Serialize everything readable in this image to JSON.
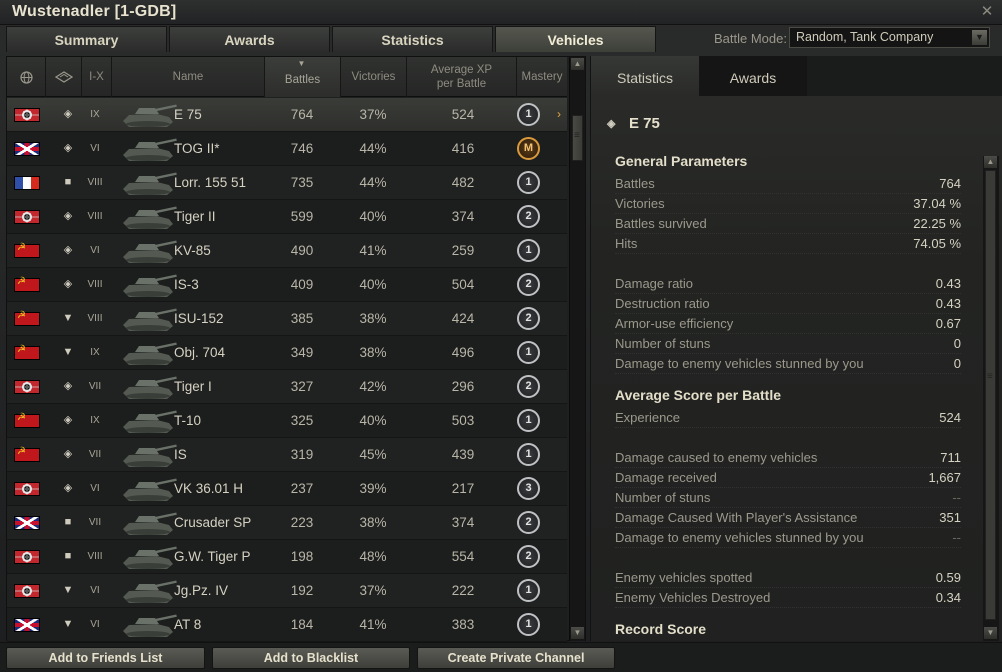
{
  "window": {
    "title": "Wustenadler [1-GDB]"
  },
  "tabs": [
    {
      "label": "Summary",
      "active": false
    },
    {
      "label": "Awards",
      "active": false
    },
    {
      "label": "Statistics",
      "active": false
    },
    {
      "label": "Vehicles",
      "active": true
    }
  ],
  "battle_mode": {
    "label": "Battle Mode:",
    "value": "Random, Tank Company"
  },
  "table": {
    "headers": {
      "name": "Name",
      "battles": "Battles",
      "victories": "Victories",
      "avg_xp_line1": "Average XP",
      "avg_xp_line2": "per Battle",
      "mastery": "Mastery",
      "tier": "I-X"
    },
    "rows": [
      {
        "nation": "de",
        "cls": "heavy",
        "tier": "IX",
        "name": "E 75",
        "battles": "764",
        "victories": "37%",
        "avg_xp": "524",
        "mastery": "1",
        "selected": true
      },
      {
        "nation": "gb",
        "cls": "heavy",
        "tier": "VI",
        "name": "TOG II*",
        "battles": "746",
        "victories": "44%",
        "avg_xp": "416",
        "mastery": "M"
      },
      {
        "nation": "fr",
        "cls": "spg",
        "tier": "VIII",
        "name": "Lorr. 155 51",
        "battles": "735",
        "victories": "44%",
        "avg_xp": "482",
        "mastery": "1"
      },
      {
        "nation": "de",
        "cls": "heavy",
        "tier": "VIII",
        "name": "Tiger II",
        "battles": "599",
        "victories": "40%",
        "avg_xp": "374",
        "mastery": "2"
      },
      {
        "nation": "su",
        "cls": "heavy",
        "tier": "VI",
        "name": "KV-85",
        "battles": "490",
        "victories": "41%",
        "avg_xp": "259",
        "mastery": "1"
      },
      {
        "nation": "su",
        "cls": "heavy",
        "tier": "VIII",
        "name": "IS-3",
        "battles": "409",
        "victories": "40%",
        "avg_xp": "504",
        "mastery": "2"
      },
      {
        "nation": "su",
        "cls": "td",
        "tier": "VIII",
        "name": "ISU-152",
        "battles": "385",
        "victories": "38%",
        "avg_xp": "424",
        "mastery": "2"
      },
      {
        "nation": "su",
        "cls": "td",
        "tier": "IX",
        "name": "Obj. 704",
        "battles": "349",
        "victories": "38%",
        "avg_xp": "496",
        "mastery": "1"
      },
      {
        "nation": "de",
        "cls": "heavy",
        "tier": "VII",
        "name": "Tiger I",
        "battles": "327",
        "victories": "42%",
        "avg_xp": "296",
        "mastery": "2"
      },
      {
        "nation": "su",
        "cls": "heavy",
        "tier": "IX",
        "name": "T-10",
        "battles": "325",
        "victories": "40%",
        "avg_xp": "503",
        "mastery": "1"
      },
      {
        "nation": "su",
        "cls": "heavy",
        "tier": "VII",
        "name": "IS",
        "battles": "319",
        "victories": "45%",
        "avg_xp": "439",
        "mastery": "1"
      },
      {
        "nation": "de",
        "cls": "heavy",
        "tier": "VI",
        "name": "VK 36.01 H",
        "battles": "237",
        "victories": "39%",
        "avg_xp": "217",
        "mastery": "3"
      },
      {
        "nation": "gb",
        "cls": "spg",
        "tier": "VII",
        "name": "Crusader SP",
        "battles": "223",
        "victories": "38%",
        "avg_xp": "374",
        "mastery": "2"
      },
      {
        "nation": "de",
        "cls": "spg",
        "tier": "VIII",
        "name": "G.W. Tiger P",
        "battles": "198",
        "victories": "48%",
        "avg_xp": "554",
        "mastery": "2"
      },
      {
        "nation": "de",
        "cls": "td",
        "tier": "VI",
        "name": "Jg.Pz. IV",
        "battles": "192",
        "victories": "37%",
        "avg_xp": "222",
        "mastery": "1"
      },
      {
        "nation": "gb",
        "cls": "td",
        "tier": "VI",
        "name": "AT 8",
        "battles": "184",
        "victories": "41%",
        "avg_xp": "383",
        "mastery": "1"
      }
    ]
  },
  "right_tabs": [
    {
      "label": "Statistics",
      "active": true
    },
    {
      "label": "Awards",
      "active": false
    }
  ],
  "detail": {
    "vehicle": "E 75",
    "general_title": "General Parameters",
    "general": [
      {
        "label": "Battles",
        "value": "764"
      },
      {
        "label": "Victories",
        "value": "37.04 %"
      },
      {
        "label": "Battles survived",
        "value": "22.25 %"
      },
      {
        "label": "Hits",
        "value": "74.05 %"
      }
    ],
    "ratios": [
      {
        "label": "Damage ratio",
        "value": "0.43"
      },
      {
        "label": "Destruction ratio",
        "value": "0.43"
      },
      {
        "label": "Armor-use efficiency",
        "value": "0.67"
      },
      {
        "label": "Number of stuns",
        "value": "0"
      },
      {
        "label": "Damage to enemy vehicles stunned by you",
        "value": "0"
      }
    ],
    "avg_title": "Average Score per Battle",
    "avg_exp": [
      {
        "label": "Experience",
        "value": "524"
      }
    ],
    "avg_damage": [
      {
        "label": "Damage caused to enemy vehicles",
        "value": "711"
      },
      {
        "label": "Damage received",
        "value": "1,667"
      },
      {
        "label": "Number of stuns",
        "value": "--"
      },
      {
        "label": "Damage Caused With Player's Assistance",
        "value": "351"
      },
      {
        "label": "Damage to enemy vehicles stunned by you",
        "value": "--"
      }
    ],
    "avg_spot": [
      {
        "label": "Enemy vehicles spotted",
        "value": "0.59"
      },
      {
        "label": "Enemy Vehicles Destroyed",
        "value": "0.34"
      }
    ],
    "record_title": "Record Score"
  },
  "footer": {
    "add_friends": "Add to Friends List",
    "blacklist": "Add to Blacklist",
    "private_channel": "Create Private Channel"
  },
  "colors": {
    "accent": "#e5a640",
    "background": "#1e1f1f"
  }
}
